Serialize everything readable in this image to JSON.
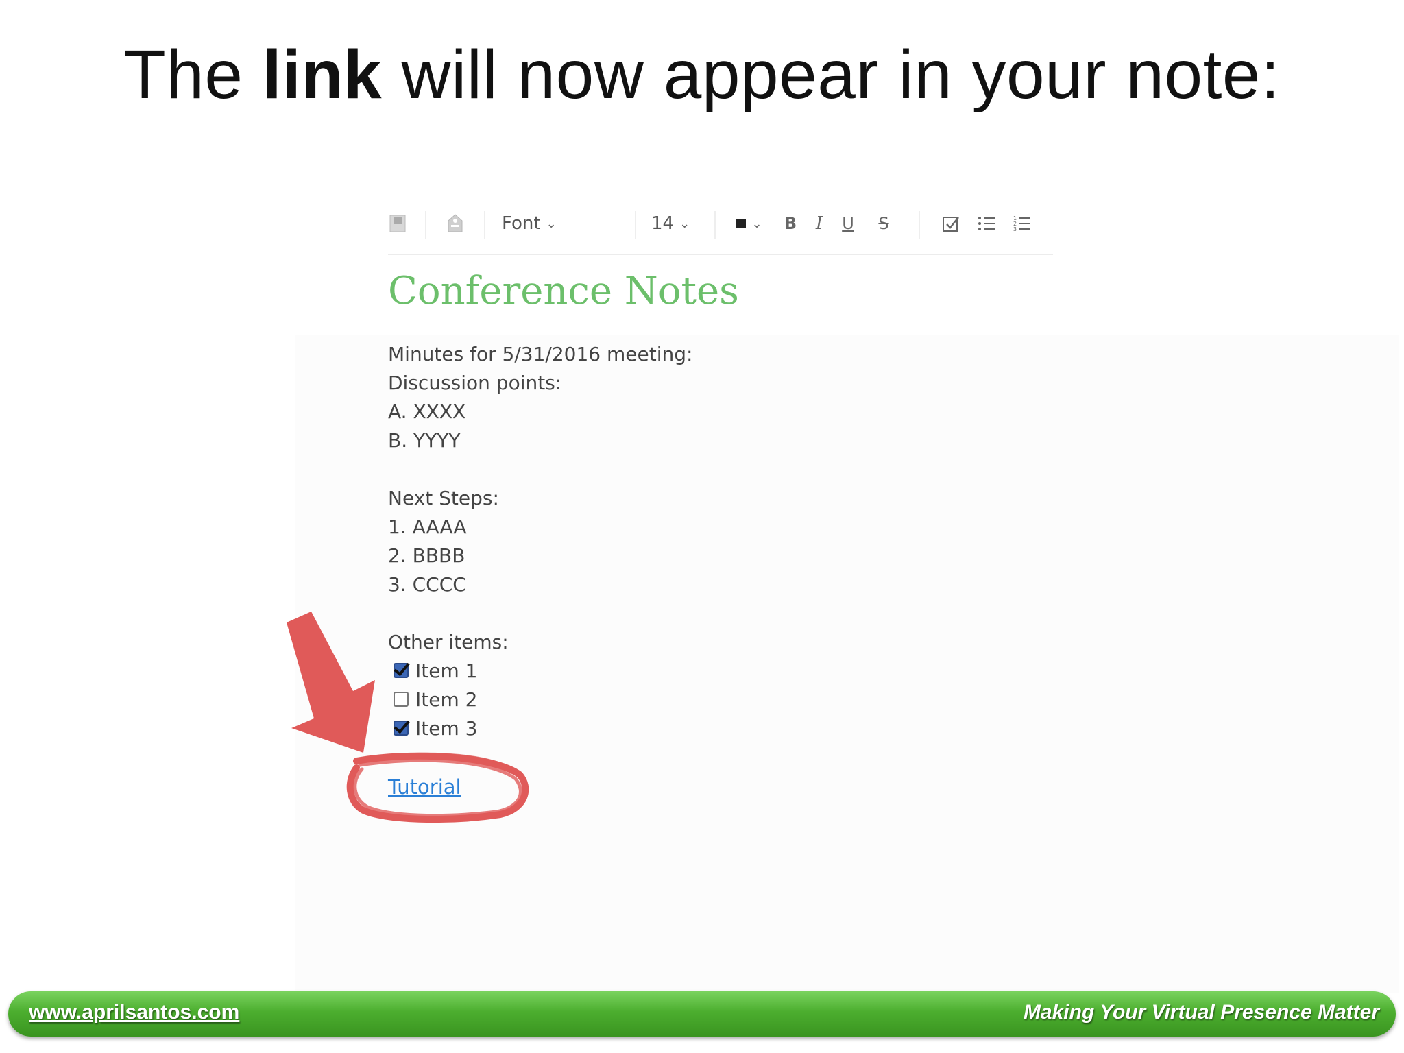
{
  "slide": {
    "title_pre": "The ",
    "title_bold": "link",
    "title_post": " will now appear in your note:"
  },
  "toolbar": {
    "notebook_icon": "notebook-icon",
    "tag_icon": "tag-icon",
    "font_label": "Font",
    "size_label": "14",
    "color_icon": "color-swatch-icon",
    "bold_label": "B",
    "italic_label": "I",
    "underline_label": "U",
    "strike_label": "S",
    "checkbox_icon": "checkbox-icon",
    "bullet_icon": "bulleted-list-icon",
    "numbered_icon": "numbered-list-icon"
  },
  "note": {
    "title": "Conference Notes",
    "lines": {
      "minutes": "Minutes for 5/31/2016 meeting:",
      "discussion": "Discussion points:",
      "a": "A. XXXX",
      "b": "B. YYYY",
      "next": "Next Steps:",
      "n1": "1. AAAA",
      "n2": "2. BBBB",
      "n3": "3. CCCC",
      "other": "Other items:"
    },
    "checklist": [
      {
        "label": "Item 1",
        "checked": true
      },
      {
        "label": "Item 2",
        "checked": false
      },
      {
        "label": "Item 3",
        "checked": true
      }
    ],
    "link_text": "Tutorial"
  },
  "annotation": {
    "arrow_color": "#e05a59",
    "circle_color": "#e05a59"
  },
  "footer": {
    "url": "www.aprilsantos.com",
    "tagline": "Making Your Virtual Presence Matter",
    "bar_color": "#4cae2f"
  }
}
